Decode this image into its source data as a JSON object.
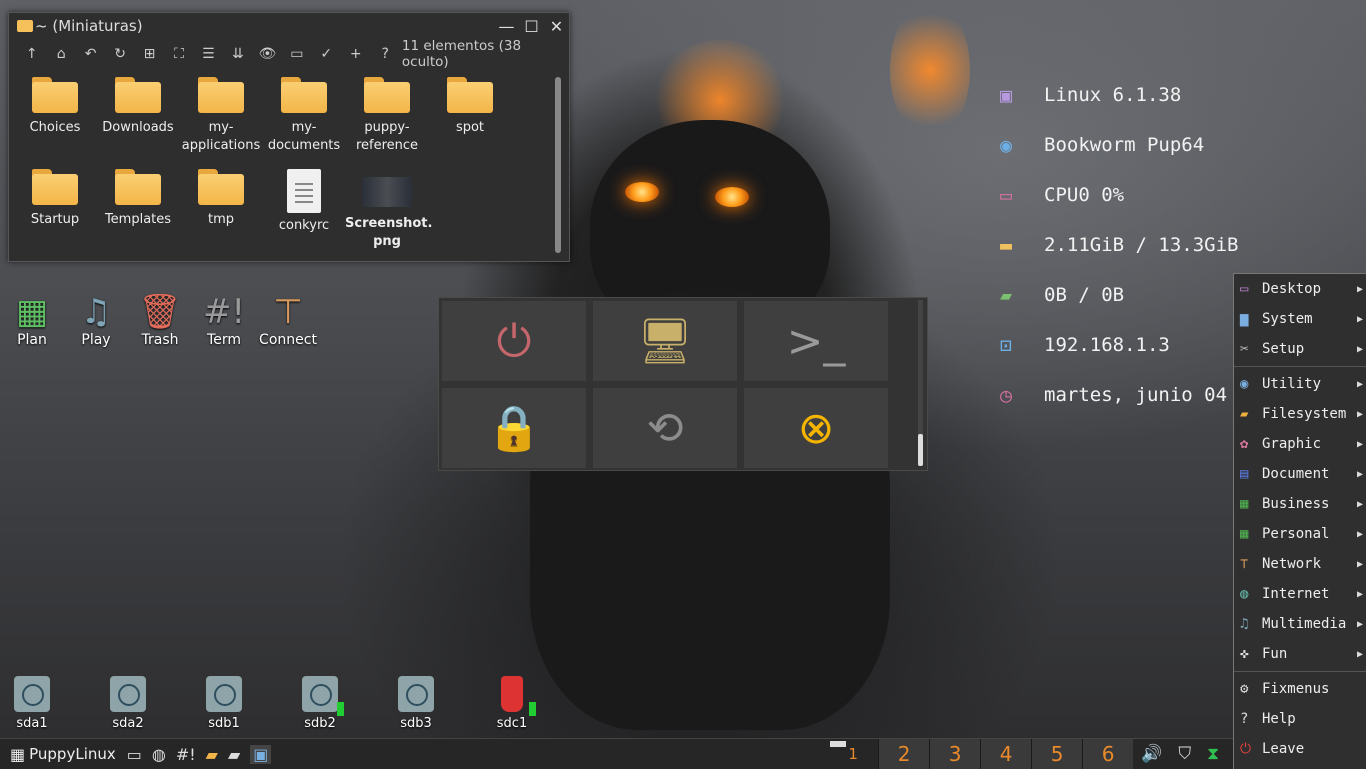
{
  "file_manager": {
    "title": "~ (Miniaturas)",
    "window_buttons": {
      "minimize": "—",
      "maximize": "☐",
      "close": "✕"
    },
    "toolbar_icons": [
      "up-icon",
      "home-icon",
      "back-icon",
      "refresh-icon",
      "new-icon",
      "fullscreen-icon",
      "list-icon",
      "sort-icon",
      "eye-icon",
      "folder-icon",
      "check-icon",
      "plus-icon",
      "help-icon"
    ],
    "toolbar_glyphs": [
      "↑",
      "⌂",
      "↶",
      "↻",
      "⊞",
      "⛶",
      "☰",
      "⇊",
      "👁",
      "▭",
      "✓",
      "+",
      "?"
    ],
    "item_count": "11 elementos (38 oculto)",
    "items": [
      {
        "label": "Choices",
        "kind": "folder"
      },
      {
        "label": "Downloads",
        "kind": "folder"
      },
      {
        "label": "my-\napplications",
        "kind": "folder"
      },
      {
        "label": "my-\ndocuments",
        "kind": "folder"
      },
      {
        "label": "puppy-\nreference",
        "kind": "folder"
      },
      {
        "label": "spot",
        "kind": "folder"
      },
      {
        "label": "Startup",
        "kind": "folder"
      },
      {
        "label": "Templates",
        "kind": "folder"
      },
      {
        "label": "tmp",
        "kind": "folder"
      },
      {
        "label": "conkyrc",
        "kind": "document"
      },
      {
        "label": "Screenshot.\npng",
        "kind": "image"
      }
    ]
  },
  "desktop_icons": [
    {
      "label": "Plan",
      "icon": "calendar-icon",
      "glyph": "▦",
      "color": "#5fbf63"
    },
    {
      "label": "Play",
      "icon": "music-note-icon",
      "glyph": "♫",
      "color": "#7fa6b8"
    },
    {
      "label": "Trash",
      "icon": "trash-icon",
      "glyph": "🗑",
      "color": "#e06c5c"
    },
    {
      "label": "Term",
      "icon": "terminal-icon",
      "glyph": "#!",
      "color": "#9a9a9a"
    },
    {
      "label": "Connect",
      "icon": "network-icon",
      "glyph": "⊤",
      "color": "#d79a5c"
    }
  ],
  "drives": [
    {
      "label": "sda1",
      "active": false
    },
    {
      "label": "sda2",
      "active": false
    },
    {
      "label": "sdb1",
      "active": false
    },
    {
      "label": "sdb2",
      "active": true
    },
    {
      "label": "sdb3",
      "active": false
    },
    {
      "label": "sdc1",
      "active": true,
      "usb": true
    }
  ],
  "power_menu": [
    {
      "name": "shutdown",
      "icon": "power-icon",
      "glyph": "⏻",
      "color": "#c4666b"
    },
    {
      "name": "display",
      "icon": "monitor-icon",
      "glyph": "🖥",
      "color": "#c8b06a"
    },
    {
      "name": "terminal",
      "icon": "terminal-icon",
      "glyph": ">_",
      "color": "#9a9a9a"
    },
    {
      "name": "lock",
      "icon": "lock-icon",
      "glyph": "🔒",
      "color": "#9bc08a"
    },
    {
      "name": "restart",
      "icon": "restart-icon",
      "glyph": "⟲",
      "color": "#8c8c8c"
    },
    {
      "name": "rescue",
      "icon": "lifebuoy-icon",
      "glyph": "⊗",
      "color": "#f4b400"
    }
  ],
  "conky": [
    {
      "icon": "cpu-chip-icon",
      "glyph": "▣",
      "color": "#b79ae0",
      "text": "Linux 6.1.38"
    },
    {
      "icon": "puppy-icon",
      "glyph": "◉",
      "color": "#6db0e8",
      "text": "Bookworm Pup64"
    },
    {
      "icon": "monitor-icon",
      "glyph": "▭",
      "color": "#d070a0",
      "text": "CPU0 0%"
    },
    {
      "icon": "memory-icon",
      "glyph": "▬",
      "color": "#f0c060",
      "text": "2.11GiB / 13.3GiB"
    },
    {
      "icon": "home-folder-icon",
      "glyph": "▰",
      "color": "#7ac070",
      "text": "0B / 0B"
    },
    {
      "icon": "network-ip-icon",
      "glyph": "⊡",
      "color": "#6db0e8",
      "text": "192.168.1.3"
    },
    {
      "icon": "clock-icon",
      "glyph": "◷",
      "color": "#d070a0",
      "text": "martes, junio 04"
    }
  ],
  "menu": {
    "groups": [
      [
        {
          "label": "Desktop",
          "icon": "desktop-icon",
          "glyph": "▭",
          "color": "#c084d0",
          "submenu": true
        },
        {
          "label": "System",
          "icon": "system-icon",
          "glyph": "▆",
          "color": "#7aaee0",
          "submenu": true
        },
        {
          "label": "Setup",
          "icon": "wrench-icon",
          "glyph": "✂",
          "color": "#cccccc",
          "submenu": true
        }
      ],
      [
        {
          "label": "Utility",
          "icon": "utility-icon",
          "glyph": "◉",
          "color": "#7ab0e0",
          "submenu": true
        },
        {
          "label": "Filesystem",
          "icon": "folder-icon",
          "glyph": "▰",
          "color": "#f0b040",
          "submenu": true
        },
        {
          "label": "Graphic",
          "icon": "palette-icon",
          "glyph": "✿",
          "color": "#e07aa0",
          "submenu": true
        },
        {
          "label": "Document",
          "icon": "document-icon",
          "glyph": "▤",
          "color": "#5a7ae0",
          "submenu": true
        },
        {
          "label": "Business",
          "icon": "spreadsheet-icon",
          "glyph": "▦",
          "color": "#50b050",
          "submenu": true
        },
        {
          "label": "Personal",
          "icon": "calendar-icon",
          "glyph": "▦",
          "color": "#50b050",
          "submenu": true
        },
        {
          "label": "Network",
          "icon": "network-icon",
          "glyph": "⊤",
          "color": "#d79a5c",
          "submenu": true
        },
        {
          "label": "Internet",
          "icon": "globe-icon",
          "glyph": "◍",
          "color": "#60b0a0",
          "submenu": true
        },
        {
          "label": "Multimedia",
          "icon": "music-note-icon",
          "glyph": "♫",
          "color": "#7fa6b8",
          "submenu": true
        },
        {
          "label": "Fun",
          "icon": "gamepad-icon",
          "glyph": "✜",
          "color": "#dddddd",
          "submenu": true
        }
      ],
      [
        {
          "label": "Fixmenus",
          "icon": "gear-icon",
          "glyph": "⚙",
          "color": "#dddddd",
          "submenu": false
        },
        {
          "label": "Help",
          "icon": "help-icon",
          "glyph": "?",
          "color": "#dddddd",
          "submenu": false
        },
        {
          "label": "Leave",
          "icon": "power-icon",
          "glyph": "⏻",
          "color": "#e04040",
          "submenu": false
        }
      ]
    ]
  },
  "taskbar": {
    "start_label": "PuppyLinux",
    "quicklaunch": [
      {
        "icon": "monitor-icon",
        "glyph": "▭"
      },
      {
        "icon": "globe-icon",
        "glyph": "◍"
      },
      {
        "icon": "terminal-icon",
        "glyph": "#!"
      },
      {
        "icon": "folder-icon",
        "glyph": "▰"
      },
      {
        "icon": "file-manager-icon",
        "glyph": "▰"
      },
      {
        "icon": "window-icon",
        "glyph": "▣"
      }
    ],
    "current_workspace": "1",
    "workspaces": [
      "2",
      "3",
      "4",
      "5",
      "6"
    ],
    "tray": [
      {
        "icon": "volume-icon",
        "glyph": "🔊"
      },
      {
        "icon": "shield-icon",
        "glyph": "⛉"
      },
      {
        "icon": "hourglass-icon",
        "glyph": "⧗"
      }
    ]
  }
}
